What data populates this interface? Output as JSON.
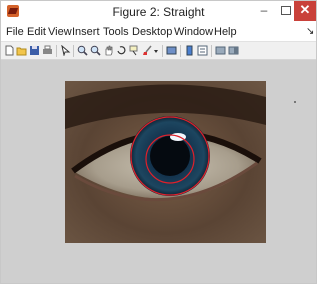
{
  "window": {
    "title": "Figure 2: Straight",
    "minimize_label": "–",
    "close_label": "✕"
  },
  "menu": {
    "items": [
      "File",
      "Edit",
      "View",
      "Insert",
      "Tools",
      "Desktop",
      "Window",
      "Help"
    ],
    "dock_arrow": "↘"
  },
  "toolbar": {
    "icons": [
      "new-figure-icon",
      "open-file-icon",
      "save-figure-icon",
      "print-figure-icon",
      "edit-plot-icon",
      "zoom-in-icon",
      "zoom-out-icon",
      "pan-icon",
      "rotate-3d-icon",
      "data-cursor-icon",
      "brush-icon",
      "brush-dropdown-icon",
      "link-plot-icon",
      "colorbar-icon",
      "legend-icon",
      "hide-plot-tools-icon",
      "show-plot-tools-icon"
    ]
  },
  "figure": {
    "image": "eye-photo",
    "overlays": [
      "red-circle-outer-iris",
      "red-circle-inner-pupil"
    ],
    "overlay_color": "#e0202a"
  }
}
